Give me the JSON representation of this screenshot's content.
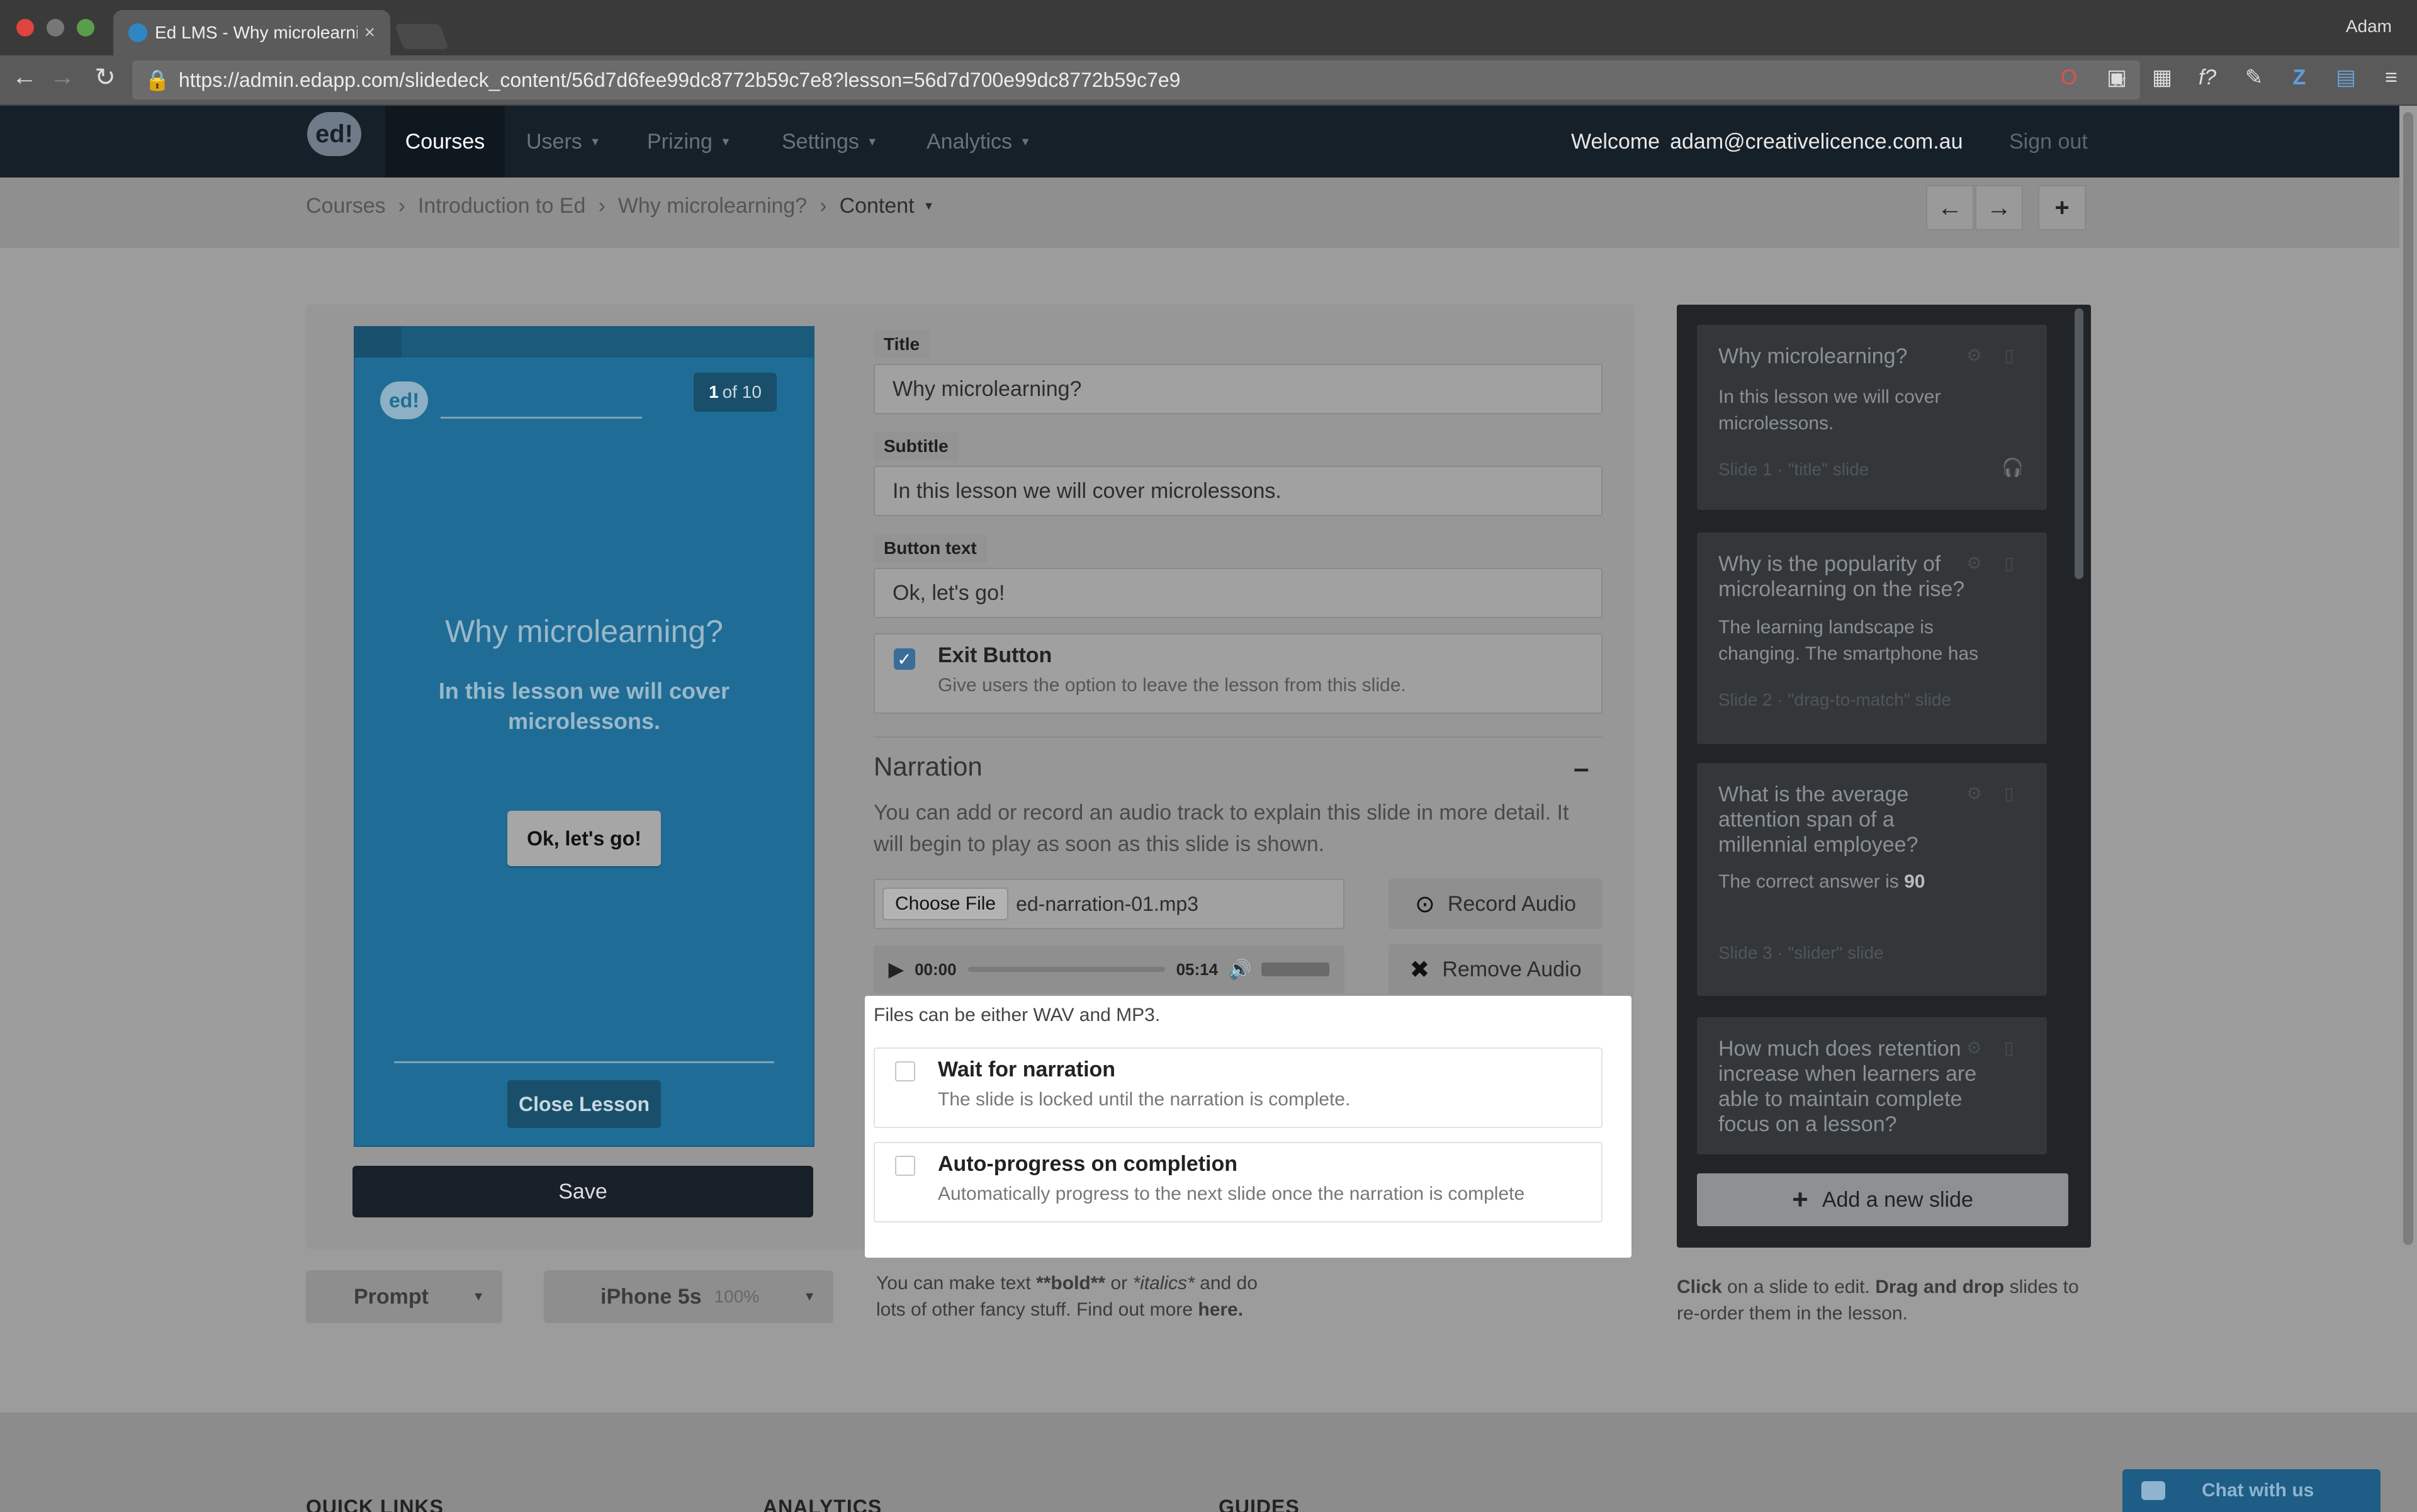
{
  "browser": {
    "tab_title": "Ed LMS - Why microlearning?",
    "tab_close": "×",
    "profile": "Adam",
    "url": "https://admin.edapp.com/slidedeck_content/56d7d6fee99dc8772b59c7e8?lesson=56d7d700e99dc8772b59c7e9"
  },
  "header": {
    "logo": "ed!",
    "nav": [
      {
        "label": "Courses"
      },
      {
        "label": "Users"
      },
      {
        "label": "Prizing"
      },
      {
        "label": "Settings"
      },
      {
        "label": "Analytics"
      }
    ],
    "welcome_label": "Welcome",
    "user_email": "adam@creativelicence.com.au",
    "sign_out": "Sign out"
  },
  "breadcrumb": {
    "items": [
      "Courses",
      "Introduction to Ed",
      "Why microlearning?",
      "Content"
    ],
    "separator": "›"
  },
  "preview": {
    "logo": "ed!",
    "counter_current": "1",
    "counter_rest": "of 10",
    "title": "Why microlearning?",
    "subtitle": "In this lesson we will cover microlessons.",
    "button": "Ok, let's go!",
    "close": "Close Lesson",
    "save": "Save",
    "orientation": "Prompt",
    "device": "iPhone 5s",
    "zoom": "100%"
  },
  "form": {
    "title_label": "Title",
    "title_value": "Why microlearning?",
    "subtitle_label": "Subtitle",
    "subtitle_value": "In this lesson we will cover microlessons.",
    "button_label": "Button text",
    "button_value": "Ok, let's go!",
    "exit_title": "Exit Button",
    "exit_desc": "Give users the option to leave the lesson from this slide.",
    "exit_checked": true,
    "narration_title": "Narration",
    "narration_collapse": "–",
    "narration_desc": "You can add or record an audio track to explain this slide in more detail. It will begin to play as soon as this slide is shown.",
    "choose_file": "Choose File",
    "file_name": "ed-narration-01.mp3",
    "record_audio": "Record Audio",
    "remove_audio": "Remove Audio",
    "audio_current": "00:00",
    "audio_duration": "05:14",
    "files_note": "Files can be either WAV and MP3.",
    "wait_title": "Wait for narration",
    "wait_desc": "The slide is locked until the narration is complete.",
    "auto_title": "Auto-progress on completion",
    "auto_desc": "Automatically progress to the next slide once the narration is complete",
    "md_help_1": "You can make text ",
    "md_bold": "**bold**",
    "md_help_2": " or ",
    "md_italic": "*italics*",
    "md_help_3": " and do lots of other fancy stuff. Find out more ",
    "md_link": "here."
  },
  "slides": {
    "items": [
      {
        "question": "Why microlearning?",
        "answer": "In this lesson we will cover microlessons.",
        "meta": "Slide 1 · \"title\" slide"
      },
      {
        "question": "Why is the popularity of microlearning on the rise?",
        "answer": "The learning landscape is changing. The smartphone has",
        "meta": "Slide 2 · \"drag-to-match\" slide"
      },
      {
        "question": "What is the average attention span of a millennial employee?",
        "answer_prefix": "The correct answer is ",
        "answer_value": "90",
        "meta": "Slide 3 · \"slider\" slide"
      },
      {
        "question": "How much does retention increase when learners are able to maintain complete focus on a lesson?"
      }
    ],
    "add_label": "Add a new slide",
    "help_click": "Click",
    "help_1": " on a slide to edit. ",
    "help_drag": "Drag and drop",
    "help_2": " slides to re-order them in the lesson."
  },
  "footer": {
    "headings": [
      "QUICK LINKS",
      "ANALYTICS",
      "GUIDES"
    ],
    "chat": "Chat with us"
  }
}
